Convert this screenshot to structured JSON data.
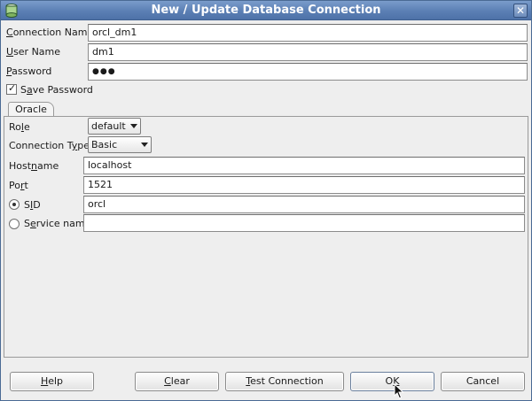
{
  "window": {
    "title": "New / Update Database Connection",
    "close_glyph": "✕"
  },
  "connection": {
    "name_label_pre": "",
    "name_label_ul": "C",
    "name_label_post": "onnection Name",
    "name_value": "orcl_dm1",
    "user_label_pre": "",
    "user_label_ul": "U",
    "user_label_post": "ser Name",
    "user_value": "dm1",
    "password_label_pre": "",
    "password_label_ul": "P",
    "password_label_post": "assword",
    "password_mask": "●●●",
    "save_password_pre": "S",
    "save_password_ul": "a",
    "save_password_post": "ve Password",
    "save_password_checked": true
  },
  "tabs": [
    {
      "label": "Oracle"
    }
  ],
  "oracle": {
    "role_label_pre": "Ro",
    "role_label_ul": "l",
    "role_label_post": "e",
    "role_value": "default",
    "conn_type_label_pre": "Connection T",
    "conn_type_label_ul": "y",
    "conn_type_label_post": "pe",
    "conn_type_value": "Basic",
    "hostname_label_pre": "Host",
    "hostname_label_ul": "n",
    "hostname_label_post": "ame",
    "hostname_value": "localhost",
    "port_label_pre": "Po",
    "port_label_ul": "r",
    "port_label_post": "t",
    "port_value": "1521",
    "sid_label_pre": "S",
    "sid_label_ul": "I",
    "sid_label_post": "D",
    "sid_value": "orcl",
    "sid_selected": true,
    "service_label_pre": "S",
    "service_label_ul": "e",
    "service_label_post": "rvice name",
    "service_value": ""
  },
  "buttons": {
    "help_ul": "H",
    "help_post": "elp",
    "clear_ul": "C",
    "clear_post": "lear",
    "test_ul": "T",
    "test_post": "est Connection",
    "ok_pre": "O",
    "ok_ul": "K",
    "cancel": "Cancel"
  },
  "colors": {
    "titlebar": "#5b7fb4",
    "window_bg": "#eeeeee"
  }
}
